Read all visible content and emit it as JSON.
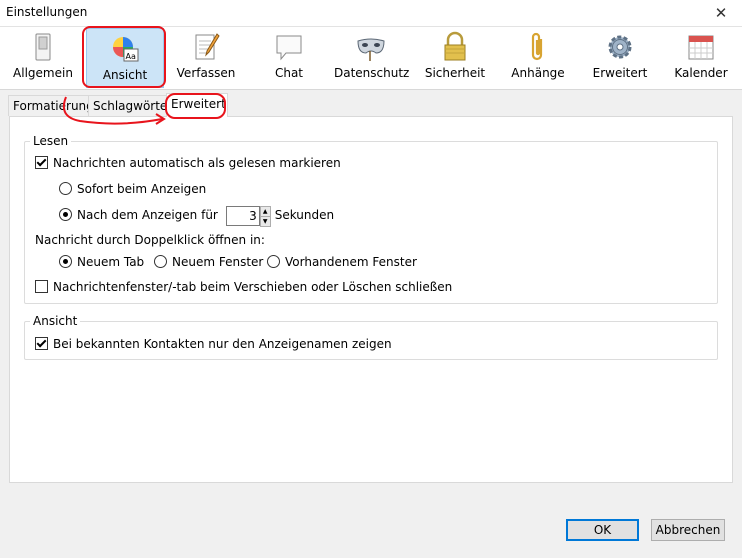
{
  "window": {
    "title": "Einstellungen",
    "close_glyph": "✕"
  },
  "toolbar": {
    "items": [
      {
        "label": "Allgemein",
        "icon": "switch-icon"
      },
      {
        "label": "Ansicht",
        "icon": "color-wheel-icon"
      },
      {
        "label": "Verfassen",
        "icon": "pen-paper-icon"
      },
      {
        "label": "Chat",
        "icon": "chat-bubble-icon"
      },
      {
        "label": "Datenschutz",
        "icon": "mask-icon"
      },
      {
        "label": "Sicherheit",
        "icon": "padlock-icon"
      },
      {
        "label": "Anhänge",
        "icon": "paperclip-icon"
      },
      {
        "label": "Erweitert",
        "icon": "gear-icon"
      },
      {
        "label": "Kalender",
        "icon": "calendar-icon"
      }
    ],
    "selected": "Ansicht",
    "colors": {
      "highlight": "#e8141c",
      "selected_bg": "#cce4f7"
    }
  },
  "subtabs": {
    "items": [
      {
        "label": "Formatierung"
      },
      {
        "label": "Schlagwörter"
      },
      {
        "label": "Erweitert"
      }
    ],
    "active": "Erweitert"
  },
  "lesen": {
    "legend": "Lesen",
    "auto_read_label": "Nachrichten automatisch als gelesen markieren",
    "immediately_label": "Sofort beim Anzeigen",
    "after_label": "Nach dem Anzeigen für",
    "seconds_value": "3",
    "seconds_unit": "Sekunden",
    "doubleclick_label": "Nachricht durch Doppelklick öffnen in:",
    "new_tab": "Neuem Tab",
    "new_window": "Neuem Fenster",
    "existing_window": "Vorhandenem Fenster",
    "close_on_move_label": "Nachrichtenfenster/-tab beim Verschieben oder Löschen schließen"
  },
  "ansicht": {
    "legend": "Ansicht",
    "display_name_label": "Bei bekannten Kontakten nur den Anzeigenamen zeigen"
  },
  "buttons": {
    "ok": "OK",
    "cancel": "Abbrechen"
  }
}
